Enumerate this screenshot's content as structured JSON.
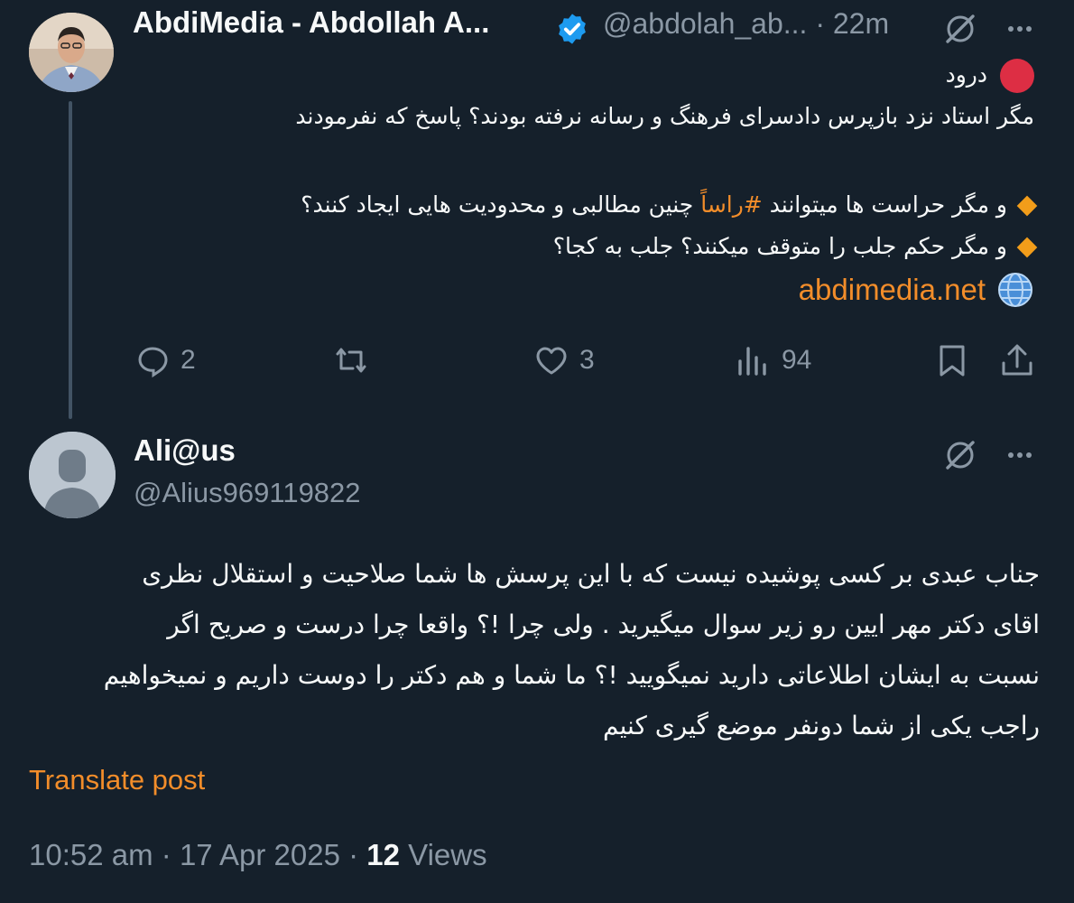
{
  "tweet1": {
    "author_name": "AbdiMedia - Abdollah A...",
    "handle": "@abdolah_ab...",
    "separator": "·",
    "time_ago": "22m",
    "lines": [
      "درود",
      "مگر استاد نزد بازپرس دادسرای فرهنگ و رسانه نرفته بودند؟ پاسخ که نفرمودند",
      "",
      "و مگر حراست ها میتوانند",
      "#راساً",
      "چنین مطالبی و محدودیت هایی ایجاد کنند؟",
      "و مگر حکم جلب را متوقف میکنند؟ جلب به کجا؟"
    ],
    "link": "abdimedia.net",
    "actions": {
      "replies": "2",
      "retweets": "",
      "likes": "3",
      "views": "94"
    }
  },
  "tweet2": {
    "author_name": "Ali@us",
    "handle": "@Alius969119822",
    "lines": [
      "جناب عبدی بر کسی پوشیده نیست که با این پرسش ها شما صلاحیت و استقلال نظری",
      "اقای دکتر مهر ایین رو زیر سوال میگیرید . ولی چرا !؟ واقعا چرا درست و صریح اگر",
      "نسبت به ایشان اطلاعاتی دارید نمیگویید !؟ ما شما و هم دکتر را دوست داریم و نمیخواهیم",
      "راجب یکی از شما دونفر موضع گیری کنیم"
    ],
    "translate_label": "Translate post",
    "time": "10:52 am",
    "date": "17 Apr 2025",
    "views_count": "12",
    "views_label": "Views",
    "sep": "·"
  },
  "colors": {
    "background": "#15202b",
    "accent": "#f28d2a",
    "verified": "#1d9bf0",
    "muted": "#8b98a5"
  },
  "icons": [
    "verified-badge-icon",
    "grok-icon",
    "more-icon",
    "red-circle-emoji",
    "orange-diamond-emoji",
    "globe-emoji",
    "reply-icon",
    "retweet-icon",
    "like-icon",
    "views-icon",
    "bookmark-icon",
    "share-icon",
    "default-avatar-icon"
  ]
}
